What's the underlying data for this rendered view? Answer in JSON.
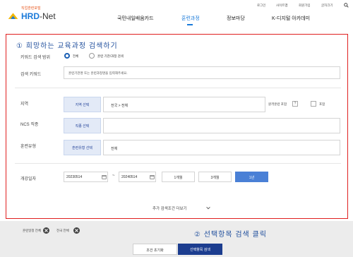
{
  "header": {
    "logo_sub": "직업훈련포털",
    "logo_main": "HRD",
    "logo_main_suffix": "-Net",
    "util": [
      "로그인",
      "사이트맵",
      "회원가입",
      "글자크기"
    ],
    "nav": [
      "국민내일배움카드",
      "훈련과정",
      "정보마당",
      "K-디지털 아카데미"
    ],
    "active_nav": "훈련과정"
  },
  "annotations": {
    "step1": "① 희망하는 교육과정 검색하기",
    "step2": "② 선택항목 검색 클릭"
  },
  "search": {
    "scope_label": "키워드 검색 범위",
    "scope_options": [
      "전체",
      "훈련 기관/과정 검색"
    ],
    "scope_selected": "전체",
    "keyword_label": "검색 키워드",
    "keyword_placeholder": "훈련기관명 또는 훈련과정명을 입력해주세요.",
    "region_label": "지역",
    "region_button": "지역 선택",
    "region_value": "전국 > 전체",
    "remote_label": "원격훈련 포함",
    "remote_help": "?",
    "remote_check_label": "포함",
    "ncs_label": "NCS 직종",
    "ncs_button": "직종 선택",
    "ncs_value": "",
    "type_label": "훈련유형",
    "type_button": "훈련유형 선택",
    "type_value": "전체",
    "period_label": "개강일자",
    "date_from": "20230514",
    "date_sep": "~",
    "date_to": "20240514",
    "period_options": [
      "1개월",
      "3개월",
      "1년"
    ],
    "period_selected": "1년",
    "more_label": "추가 검색조건 더보기"
  },
  "tags": {
    "tag1": "훈련일정 전체",
    "tag2": "전국 전체"
  },
  "buttons": {
    "reset": "조건 초기화",
    "search": "선택항목 검색"
  },
  "colors": {
    "brand_blue": "#1a7ad9",
    "annotation_blue": "#1f4e9c",
    "highlight_red": "#e02020",
    "search_button": "#1c3d8f",
    "period_selected": "#4a80d6"
  }
}
